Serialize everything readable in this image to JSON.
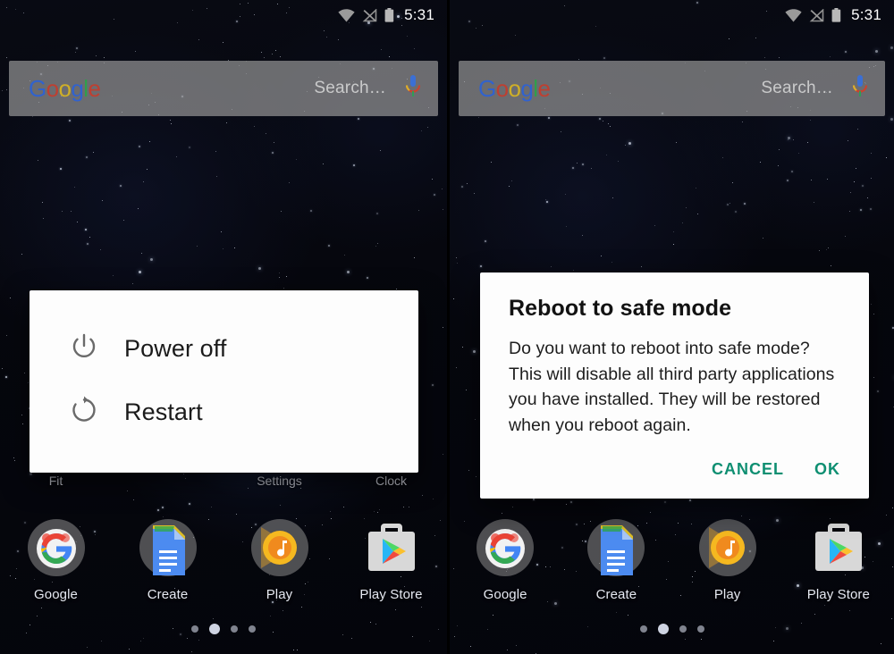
{
  "statusbar": {
    "time": "5:31",
    "icons": [
      "wifi-icon",
      "signal-off-icon",
      "battery-icon"
    ]
  },
  "search": {
    "logo_letters": [
      "G",
      "o",
      "o",
      "g",
      "l",
      "e"
    ],
    "placeholder": "Search…",
    "mic_icon": "microphone-icon"
  },
  "home": {
    "partial_app_row": [
      {
        "label": "Fit"
      },
      {
        "label": ""
      },
      {
        "label": "Settings"
      },
      {
        "label": "Clock"
      }
    ],
    "dock": [
      {
        "label": "Google",
        "icon": "google-app-icon"
      },
      {
        "label": "Create",
        "icon": "google-docs-icon"
      },
      {
        "label": "Play",
        "icon": "play-music-icon"
      },
      {
        "label": "Play Store",
        "icon": "play-store-icon"
      }
    ],
    "page_dots": {
      "count": 4,
      "active_index": 1
    }
  },
  "power_dialog": {
    "items": [
      {
        "label": "Power off",
        "icon": "power-icon"
      },
      {
        "label": "Restart",
        "icon": "restart-icon"
      }
    ]
  },
  "reboot_dialog": {
    "title": "Reboot to safe mode",
    "body": "Do you want to reboot into safe mode? This will disable all third party applications you have installed. They will be restored when you reboot again.",
    "cancel_label": "CANCEL",
    "ok_label": "OK",
    "action_color": "#0f8f72"
  },
  "colors": {
    "dialog_background": "#fdfdfd",
    "search_bar": "rgba(160,160,160,0.66)",
    "wallpaper": "#05060c",
    "accent": "#0f8f72"
  }
}
